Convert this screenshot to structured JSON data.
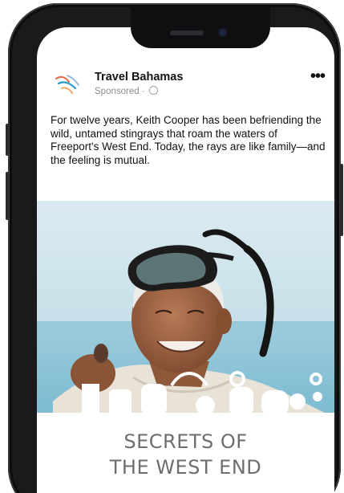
{
  "post": {
    "page_name": "Travel Bahamas",
    "sponsored": "Sponsored ·",
    "body": "For twelve years, Keith Cooper has been befriending the wild, untamed stingrays that roam the waters of Freeport's West End. Today, the rays are like family—and the feeling is mutual.",
    "more_icon": "more-options-icon",
    "privacy_icon": "globe-icon"
  },
  "media": {
    "title_line1": "SECRETS OF",
    "title_line2": "THE WEST END"
  },
  "colors": {
    "phone": "#1a1a1c",
    "sky": "#d3e6ee",
    "title_text": "#6e6e6e"
  }
}
